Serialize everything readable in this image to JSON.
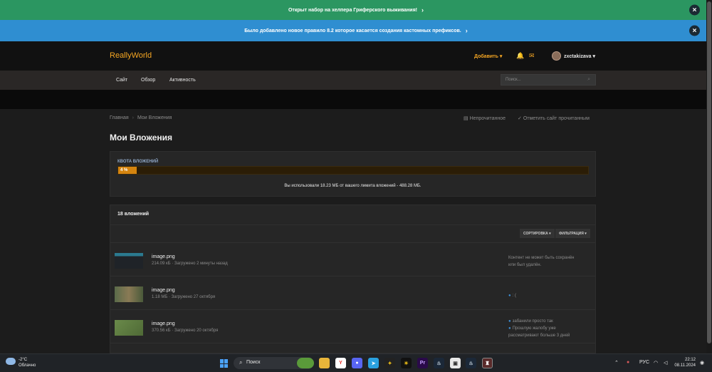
{
  "notices": {
    "green": "Открыт набор на хелпера Гриферского выживания!",
    "blue": "Было добавлено новое правило 8.2 которое касается создания кастомных префиксов."
  },
  "header": {
    "logo": "ReallyWorld",
    "add_label": "Добавить",
    "username": "zxctakizava"
  },
  "nav": {
    "items": [
      "Сайт",
      "Обзор",
      "Активность"
    ],
    "search_placeholder": "Поиск..."
  },
  "breadcrumb": {
    "home": "Главная",
    "current": "Мои Вложения"
  },
  "actions": {
    "unread": "Непрочитанное",
    "mark_read": "Отметить сайт прочитанным"
  },
  "page_title": "Мои Вложения",
  "quota": {
    "label": "КВОТА ВЛОЖЕНИЙ",
    "percent_label": "4 %",
    "fraction": 0.04,
    "text": "Вы использовали 18.23 МБ от вашего лимита вложений - 488.28 МБ."
  },
  "list": {
    "count": "18 вложений",
    "sort_label": "СОРТИРОВКА",
    "filter_label": "ФИЛЬТРАЦИЯ",
    "rows": [
      {
        "name": "image.png",
        "meta": "214.09 кБ · Загружено 2 минуты назад",
        "note1": "Контент не может быть сохранён",
        "note2": "или был удалён.",
        "note3": ""
      },
      {
        "name": "image.png",
        "meta": "1.18 МБ · Загружено 27 октября",
        "note1": ": (",
        "note2": "",
        "note3": ""
      },
      {
        "name": "image.png",
        "meta": "370.56 кБ · Загружено 20 октября",
        "note1": "забанили просто так",
        "note2": "Прошлую жалобу уже",
        "note3": "рассматривают больше 3 дней"
      }
    ]
  },
  "taskbar": {
    "temp": "-2°C",
    "condition": "Облачно",
    "search": "Поиск",
    "lang": "РУС",
    "time": "22:12",
    "date": "08.11.2024"
  },
  "colors": {
    "accent": "#f5a623",
    "notice_green": "#2b9661",
    "notice_blue": "#2f8ed1"
  }
}
